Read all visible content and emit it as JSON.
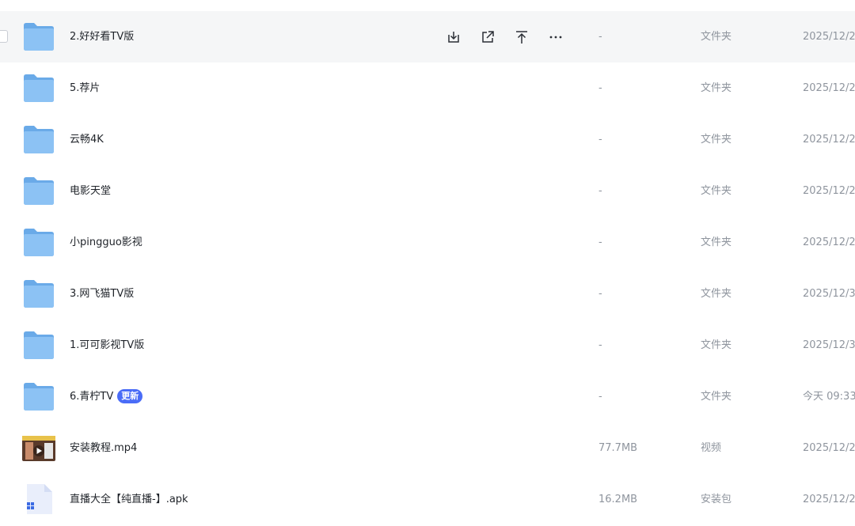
{
  "files": [
    {
      "name": "2.好好看TV版",
      "size": "-",
      "type": "文件夹",
      "date": "2025/12/2",
      "kind": "folder",
      "icon": "folder-icon"
    },
    {
      "name": "5.荐片",
      "size": "-",
      "type": "文件夹",
      "date": "2025/12/2",
      "kind": "folder",
      "icon": "folder-icon"
    },
    {
      "name": "云畅4K",
      "size": "-",
      "type": "文件夹",
      "date": "2025/12/2",
      "kind": "folder",
      "icon": "folder-icon"
    },
    {
      "name": "电影天堂",
      "size": "-",
      "type": "文件夹",
      "date": "2025/12/2",
      "kind": "folder",
      "icon": "folder-icon"
    },
    {
      "name": "小pingguo影视",
      "size": "-",
      "type": "文件夹",
      "date": "2025/12/2",
      "kind": "folder",
      "icon": "folder-icon"
    },
    {
      "name": "3.网飞猫TV版",
      "size": "-",
      "type": "文件夹",
      "date": "2025/12/3",
      "kind": "folder",
      "icon": "folder-icon"
    },
    {
      "name": "1.可可影视TV版",
      "size": "-",
      "type": "文件夹",
      "date": "2025/12/3",
      "kind": "folder",
      "icon": "folder-icon"
    },
    {
      "name": "6.青柠TV",
      "badge": "更新",
      "size": "-",
      "type": "文件夹",
      "date": "今天 09:33",
      "kind": "folder",
      "icon": "folder-icon"
    },
    {
      "name": "安装教程.mp4",
      "size": "77.7MB",
      "type": "视频",
      "date": "2025/12/2",
      "kind": "video",
      "icon": "video-thumbnail-icon"
    },
    {
      "name": "直播大全【纯直播-】.apk",
      "size": "16.2MB",
      "type": "安装包",
      "date": "2025/12/2",
      "kind": "apk",
      "icon": "apk-file-icon"
    }
  ],
  "row_actions": [
    {
      "icon": "download-icon"
    },
    {
      "icon": "share-icon"
    },
    {
      "icon": "move-to-top-icon"
    },
    {
      "icon": "more-icon"
    }
  ],
  "colors": {
    "folder": "#7fb8f0",
    "badge": "#4a6cf7",
    "hover_row": "#f5f6f7",
    "muted_text": "#8f959e"
  }
}
